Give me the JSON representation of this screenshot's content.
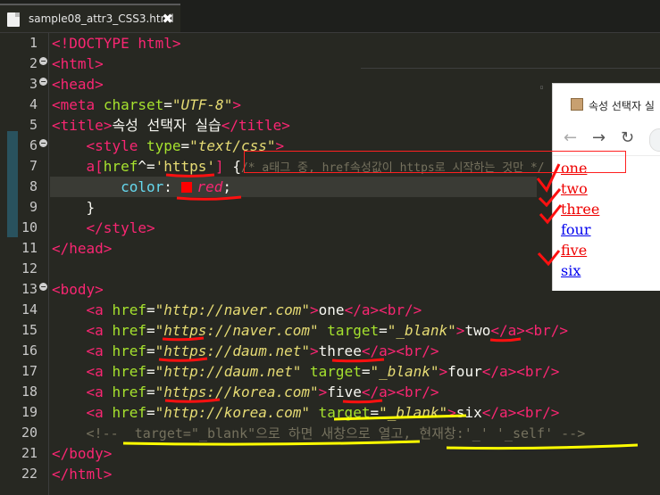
{
  "tab": {
    "filename": "sample08_attr3_CSS3.html",
    "close": "✖"
  },
  "line_numbers": [
    "1",
    "2",
    "3",
    "6",
    "7",
    "8",
    "9",
    "10",
    "11",
    "12",
    "13",
    "14",
    "15",
    "16",
    "17",
    "18",
    "19",
    "20",
    "21",
    "22"
  ],
  "code": {
    "l1": {
      "doctype": "<!DOCTYPE html>"
    },
    "l2": {
      "open": "<",
      "tag": "html",
      "close": ">"
    },
    "l3": {
      "open": "<",
      "tag": "head",
      "close": ">"
    },
    "l4": {
      "tag": "meta",
      "attr": "charset",
      "val": "\"UTF-8\""
    },
    "l5": {
      "tag": "title",
      "text": "속성 선택자 실습"
    },
    "l6": {
      "tag": "style",
      "attr": "type",
      "val": "\"text/css\""
    },
    "l7": {
      "selector_a": "a[",
      "attr": "href",
      "op": "^=",
      "val": "'https'",
      "rb": "]",
      "brace": "{",
      "comment": "/* a태그 중, href속성값이 https로 시작하는 것만 */"
    },
    "l8": {
      "prop": "color",
      "colon": ":",
      "value": "red",
      "semi": ";"
    },
    "l9": {
      "brace": "}"
    },
    "l10": {
      "tag": "style"
    },
    "l11": {
      "tag": "head"
    },
    "l13": {
      "tag": "body"
    },
    "links": [
      {
        "href": "\"http://naver.com\"",
        "target": "",
        "text": "one"
      },
      {
        "href": "\"https://naver.com\"",
        "target": "\"_blank\"",
        "text": "two"
      },
      {
        "href": "\"https://daum.net\"",
        "target": "",
        "text": "three"
      },
      {
        "href": "\"http://daum.net\"",
        "target": "\"_blank\"",
        "text": "four"
      },
      {
        "href": "\"https://korea.com\"",
        "target": "",
        "text": "five"
      },
      {
        "href": "\"http://korea.com\"",
        "target": "\"_blank\"",
        "text": "six"
      }
    ],
    "l20": {
      "comment": "<!--  target=\"_blank\"으로 하면 새창으로 열고, 현재창:'_' '_self' -->"
    },
    "l21": {
      "tag": "body"
    },
    "l22": {
      "tag": "html"
    },
    "kw": {
      "a": "a",
      "href": "href",
      "target": "target",
      "br": "br"
    }
  },
  "browser": {
    "tab_title": "속성 선택자 실",
    "nav": {
      "back": "←",
      "forward": "→",
      "reload": "↻"
    },
    "links": [
      {
        "text": "one",
        "color": "red"
      },
      {
        "text": "two",
        "color": "red"
      },
      {
        "text": "three",
        "color": "red"
      },
      {
        "text": "four",
        "color": "blue"
      },
      {
        "text": "five",
        "color": "red"
      },
      {
        "text": "six",
        "color": "blue"
      }
    ]
  },
  "colors": {
    "editor_bg": "#272822",
    "tag": "#f92672",
    "attr": "#a6e22e",
    "string": "#e6db74",
    "comment": "#75715e",
    "annotation_red": "#ff0000",
    "annotation_yellow": "#ffff00"
  }
}
